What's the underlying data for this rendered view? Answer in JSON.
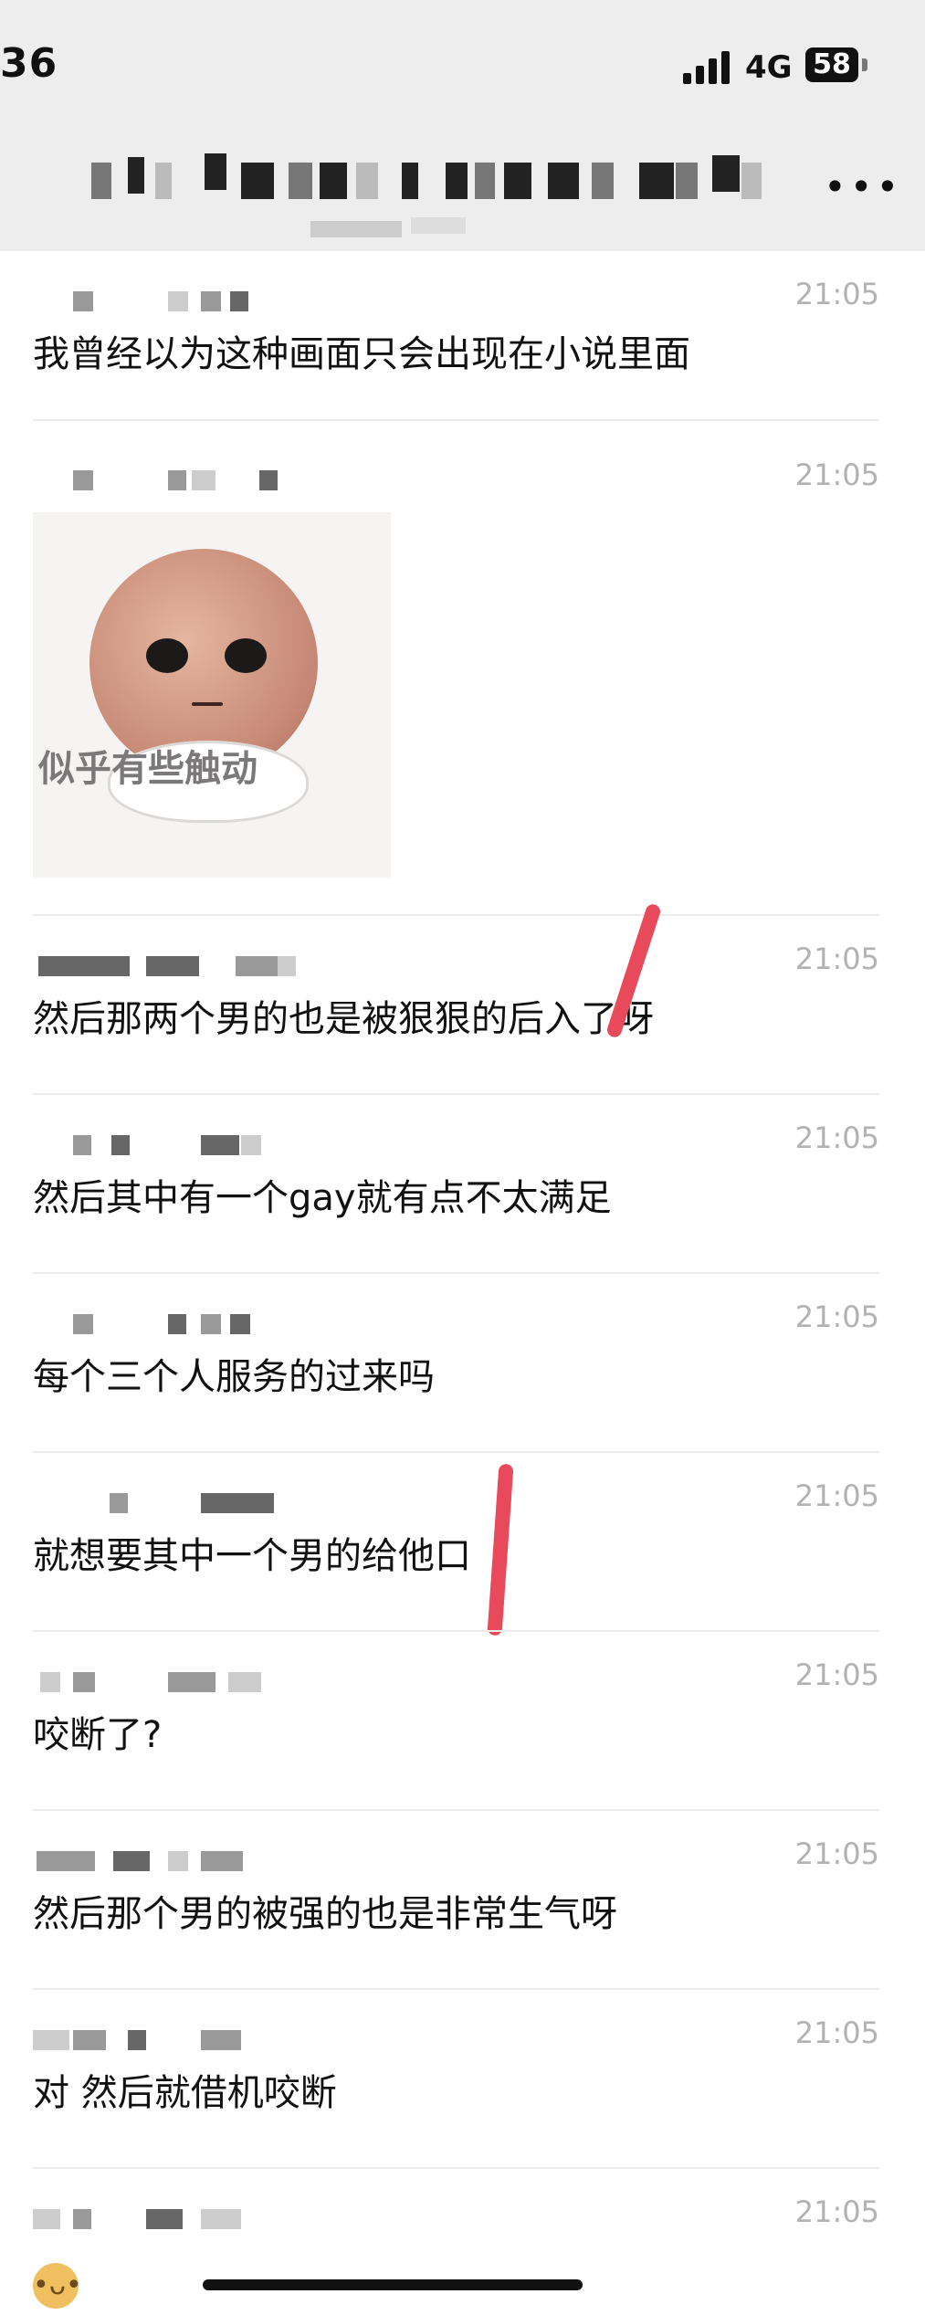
{
  "status_bar": {
    "time": "36",
    "network": "4G",
    "battery": "58"
  },
  "header": {
    "more_icon": "more-icon",
    "more_glyph": "•••"
  },
  "messages": [
    {
      "time": "21:05",
      "text": "我曾经以为这种画面只会出现在小说里面"
    },
    {
      "time": "21:05",
      "text": "",
      "sticker_caption": "似乎有些触动"
    },
    {
      "time": "21:05",
      "text": "然后那两个男的也是被狠狠的后入了呀"
    },
    {
      "time": "21:05",
      "text": "然后其中有一个gay就有点不太满足"
    },
    {
      "time": "21:05",
      "text": "每个三个人服务的过来吗"
    },
    {
      "time": "21:05",
      "text": "就想要其中一个男的给他口"
    },
    {
      "time": "21:05",
      "text": "咬断了?"
    },
    {
      "time": "21:05",
      "text": "然后那个男的被强的也是非常生气呀"
    },
    {
      "time": "21:05",
      "text": "对 然后就借机咬断"
    },
    {
      "time": "21:05",
      "text": ""
    }
  ],
  "colors": {
    "header_bg": "#ededed",
    "timestamp": "#b2b2b2",
    "annotation_red": "#e8495b"
  }
}
